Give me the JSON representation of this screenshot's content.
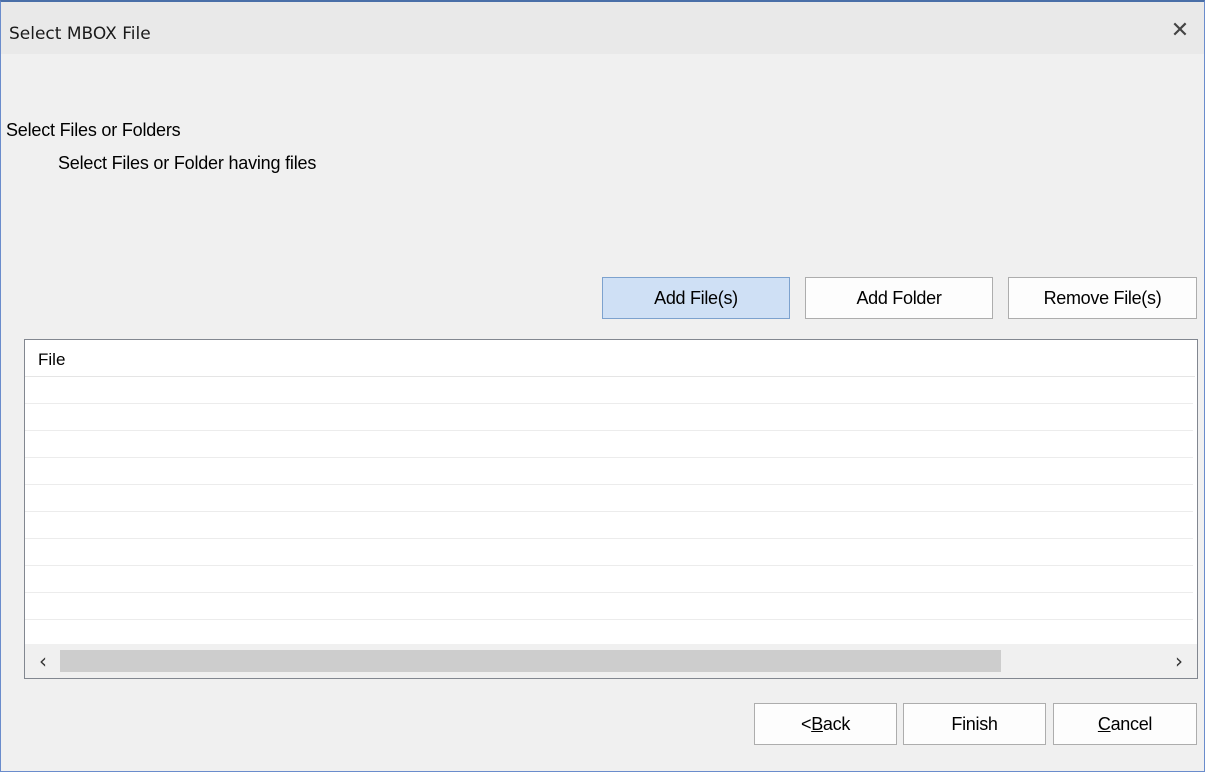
{
  "window": {
    "title": "Select MBOX File",
    "close_glyph": "✕"
  },
  "page": {
    "heading": "Select Files or Folders",
    "subheading": "Select Files or Folder having files"
  },
  "toolbar": {
    "add_files_label": "Add File(s)",
    "add_folder_label": "Add Folder",
    "remove_files_label": "Remove File(s)"
  },
  "file_list": {
    "column_header": "File",
    "rows": [],
    "scroll_left_glyph": "‹",
    "scroll_right_glyph": "›"
  },
  "footer": {
    "back_prefix": "<",
    "back_accel": "B",
    "back_rest": "ack",
    "finish_label": "Finish",
    "cancel_accel": "C",
    "cancel_rest": "ancel"
  },
  "colors": {
    "accent_button": "#cfe0f5",
    "window_border": "#4a6fa8"
  }
}
